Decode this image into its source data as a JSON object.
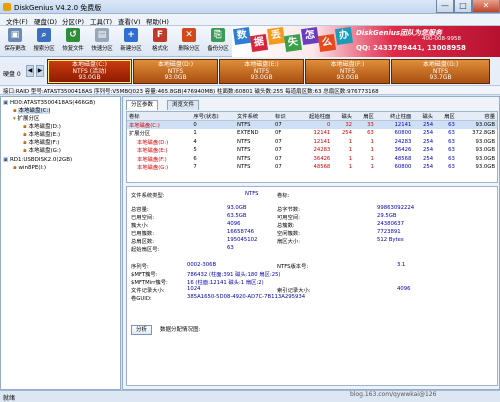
{
  "window": {
    "title": "DiskGenius V4.2.0 免费版",
    "min": "—",
    "max": "□",
    "close": "✕"
  },
  "menu": [
    "文件(F)",
    "硬盘(D)",
    "分区(P)",
    "工具(T)",
    "查看(V)",
    "帮助(H)"
  ],
  "toolbar": [
    {
      "label": "保存更改",
      "icon": "save-icon",
      "color": "#6b8bb5",
      "glyph": "▣"
    },
    {
      "label": "搜索分区",
      "icon": "search-icon",
      "color": "#3a6fbf",
      "glyph": "⌕"
    },
    {
      "label": "恢复文件",
      "icon": "recover-icon",
      "color": "#2f8d3a",
      "glyph": "↺"
    },
    {
      "label": "快速分区",
      "icon": "quick-partition-icon",
      "color": "#9aa7b8",
      "glyph": "▤"
    },
    {
      "label": "新建分区",
      "icon": "new-partition-icon",
      "color": "#2f6fd0",
      "glyph": "+"
    },
    {
      "label": "格式化",
      "icon": "format-icon",
      "color": "#c0392b",
      "glyph": "F"
    },
    {
      "label": "删除分区",
      "icon": "delete-partition-icon",
      "color": "#d04a1a",
      "glyph": "✕"
    },
    {
      "label": "备份分区",
      "icon": "backup-partition-icon",
      "color": "#3b9a57",
      "glyph": "⎘"
    }
  ],
  "banner": {
    "tiles": [
      "数",
      "据",
      "丢",
      "失",
      "怎",
      "么",
      "办"
    ],
    "brand": "DiskGenius团队为您服务",
    "phone": "400-008-9958",
    "qq": "QQ: 2433789441, 13008958"
  },
  "diskmap": {
    "label": "硬盘 0",
    "partitions": [
      {
        "name": "本地磁盘(C:)",
        "fs": "NTFS (活动)",
        "size": "93.0GB"
      },
      {
        "name": "本地磁盘(D:)",
        "fs": "NTFS",
        "size": "93.0GB"
      },
      {
        "name": "本地磁盘(E:)",
        "fs": "NTFS",
        "size": "93.0GB"
      },
      {
        "name": "本地磁盘(F:)",
        "fs": "NTFS",
        "size": "93.0GB"
      },
      {
        "name": "本地磁盘(G:)",
        "fs": "NTFS",
        "size": "93.7GB"
      }
    ]
  },
  "infobar": "接口:RAID  型号:ATAST3500418AS  序列号:V5MBQ023  容量:465.8GB(476940MB)  柱面数:60801  磁头数:255  每道扇区数:63  总扇区数:976773168",
  "tree": [
    "HD0:ATAST3500418AS(466GB)",
    "本地磁盘(C:)",
    "扩展分区",
    "本地磁盘(D:)",
    "本地磁盘(E:)",
    "本地磁盘(F:)",
    "本地磁盘(G:)",
    "RD1:USBDISK2.0(2GB)",
    "win8PE(I:)"
  ],
  "tabs": [
    "分区参数",
    "浏览文件"
  ],
  "ptable": {
    "headers": [
      "卷标",
      "序号(状态)",
      "文件系统",
      "标识",
      "起始柱面",
      "磁头",
      "扇区",
      "终止柱面",
      "磁头",
      "扇区",
      "容量"
    ],
    "rows": [
      [
        "本地磁盘(C:)",
        "0",
        "NTFS",
        "07",
        "0",
        "32",
        "33",
        "12141",
        "254",
        "63",
        "93.0GB"
      ],
      [
        "扩展分区",
        "1",
        "EXTEND",
        "0F",
        "12141",
        "254",
        "63",
        "60800",
        "254",
        "63",
        "372.8GB"
      ],
      [
        "本地磁盘(D:)",
        "4",
        "NTFS",
        "07",
        "12141",
        "1",
        "1",
        "24283",
        "254",
        "63",
        "93.0GB"
      ],
      [
        "本地磁盘(E:)",
        "5",
        "NTFS",
        "07",
        "24283",
        "1",
        "1",
        "36426",
        "254",
        "63",
        "93.0GB"
      ],
      [
        "本地磁盘(F:)",
        "6",
        "NTFS",
        "07",
        "36426",
        "1",
        "1",
        "48568",
        "254",
        "63",
        "93.0GB"
      ],
      [
        "本地磁盘(G:)",
        "7",
        "NTFS",
        "07",
        "48568",
        "1",
        "1",
        "60800",
        "254",
        "63",
        "93.0GB"
      ]
    ]
  },
  "fs": {
    "fstype_label": "文件系统类型:",
    "fstype": "NTFS",
    "vollabel_label": "卷标:",
    "left": [
      [
        "总容量:",
        "93.0GB"
      ],
      [
        "已用空间:",
        "63.5GB"
      ],
      [
        "簇大小:",
        "4096"
      ],
      [
        "已用簇数:",
        "16658746"
      ],
      [
        "总扇区数:",
        "195045102"
      ],
      [
        "起始扇区号:",
        "63"
      ]
    ],
    "right": [
      [
        "总字节数:",
        "99863092224"
      ],
      [
        "可用空间:",
        "29.5GB"
      ],
      [
        "总簇数:",
        "24380637"
      ],
      [
        "空闲簇数:",
        "7723891"
      ],
      [
        "扇区大小:",
        "512 Bytes"
      ]
    ],
    "block2": [
      [
        "序列号:",
        "0002-306B",
        "NTFS版本号:",
        "3.1"
      ],
      [
        "$MFT簇号:",
        "786432 (柱面:391 磁头:180 扇区:25)",
        "",
        ""
      ],
      [
        "$MFTMirr簇号:",
        "16 (柱面:12141 磁头:1 扇区:2)",
        "",
        ""
      ],
      [
        "文件记录大小:",
        "1024",
        "索引记录大小:",
        "4096"
      ],
      [
        "卷GUID:",
        "385A1650-5D08-4920-AD7C-7B113A295934",
        "",
        ""
      ]
    ],
    "analyze_button": "分析",
    "analyze_caption": "数据分配情况图:"
  },
  "status": {
    "left": "就绪",
    "watermark": "blog.163.com/qywwkai@126"
  }
}
